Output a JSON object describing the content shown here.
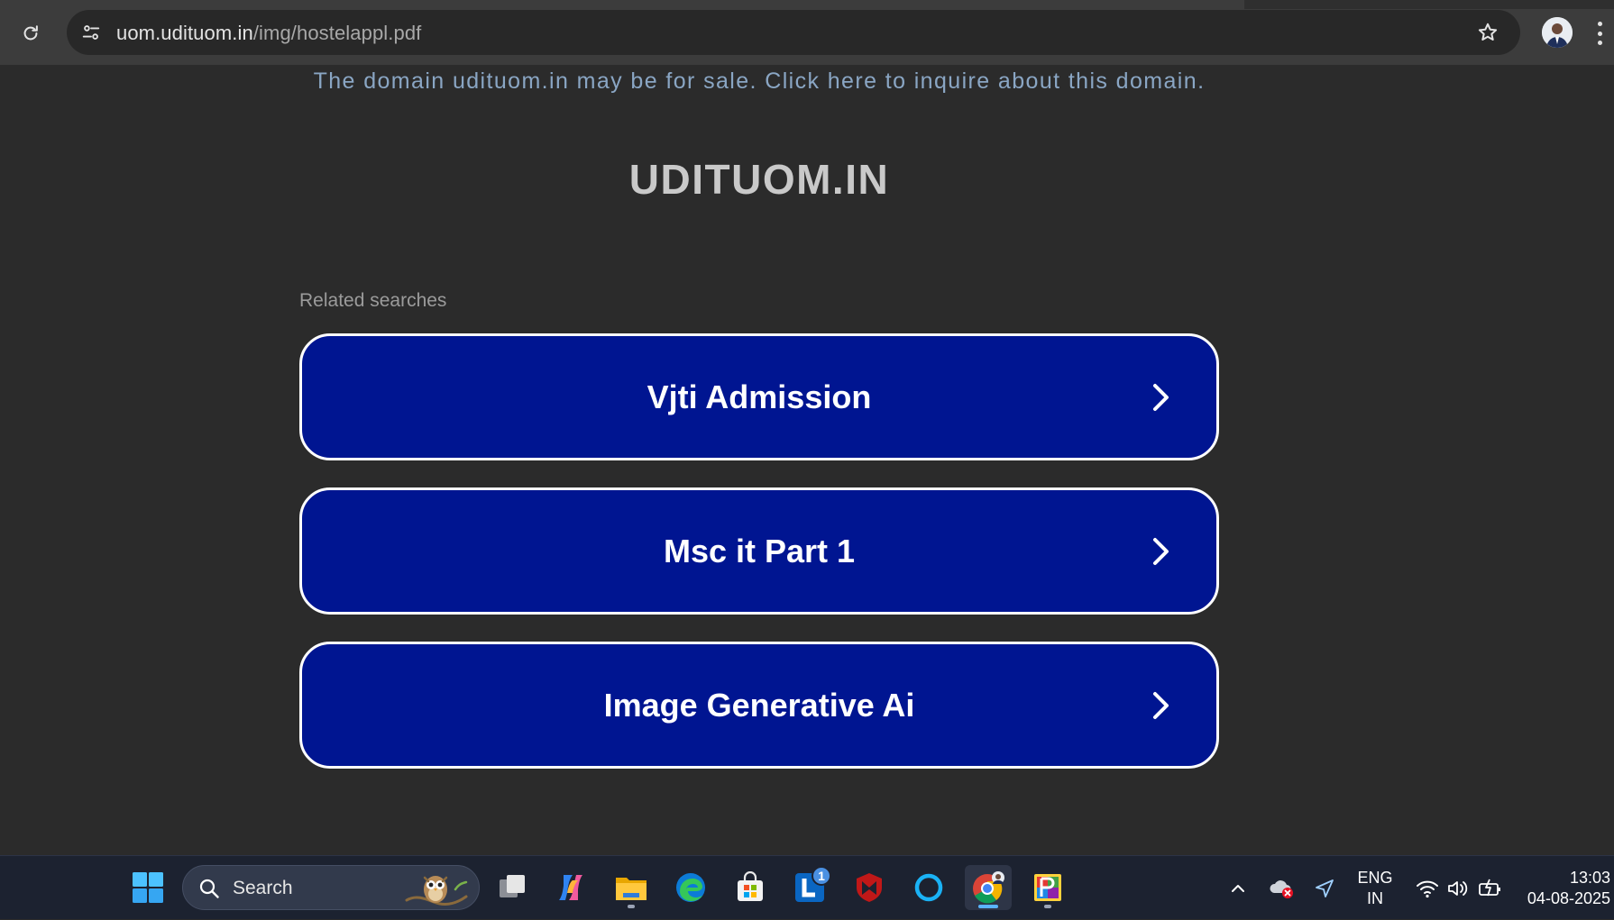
{
  "browser": {
    "url_host": "uom.udituom.in",
    "url_path": "/img/hostelappl.pdf"
  },
  "page": {
    "sale_banner": "The domain udituom.in may be for sale. Click here to inquire about this domain.",
    "site_title": "UDITUOM.IN",
    "related_label": "Related searches",
    "related_searches": [
      {
        "label": "Vjti Admission"
      },
      {
        "label": "Msc it Part 1"
      },
      {
        "label": "Image Generative Ai"
      }
    ],
    "colors": {
      "button_bg": "#001591",
      "button_border": "#ffffff",
      "background": "#2b2b2b"
    }
  },
  "taskbar": {
    "search_placeholder": "Search",
    "linkedin_badge": "1",
    "language": "ENG",
    "region": "IN",
    "time": "13:03",
    "date": "04-08-2025",
    "pinned_icons": [
      "windows-start-icon",
      "task-view-icon",
      "copilot-icon",
      "file-explorer-icon",
      "edge-icon",
      "microsoft-store-icon",
      "linkedin-icon",
      "mcafee-icon",
      "cortana-icon",
      "chrome-icon",
      "paint-app-icon"
    ]
  }
}
